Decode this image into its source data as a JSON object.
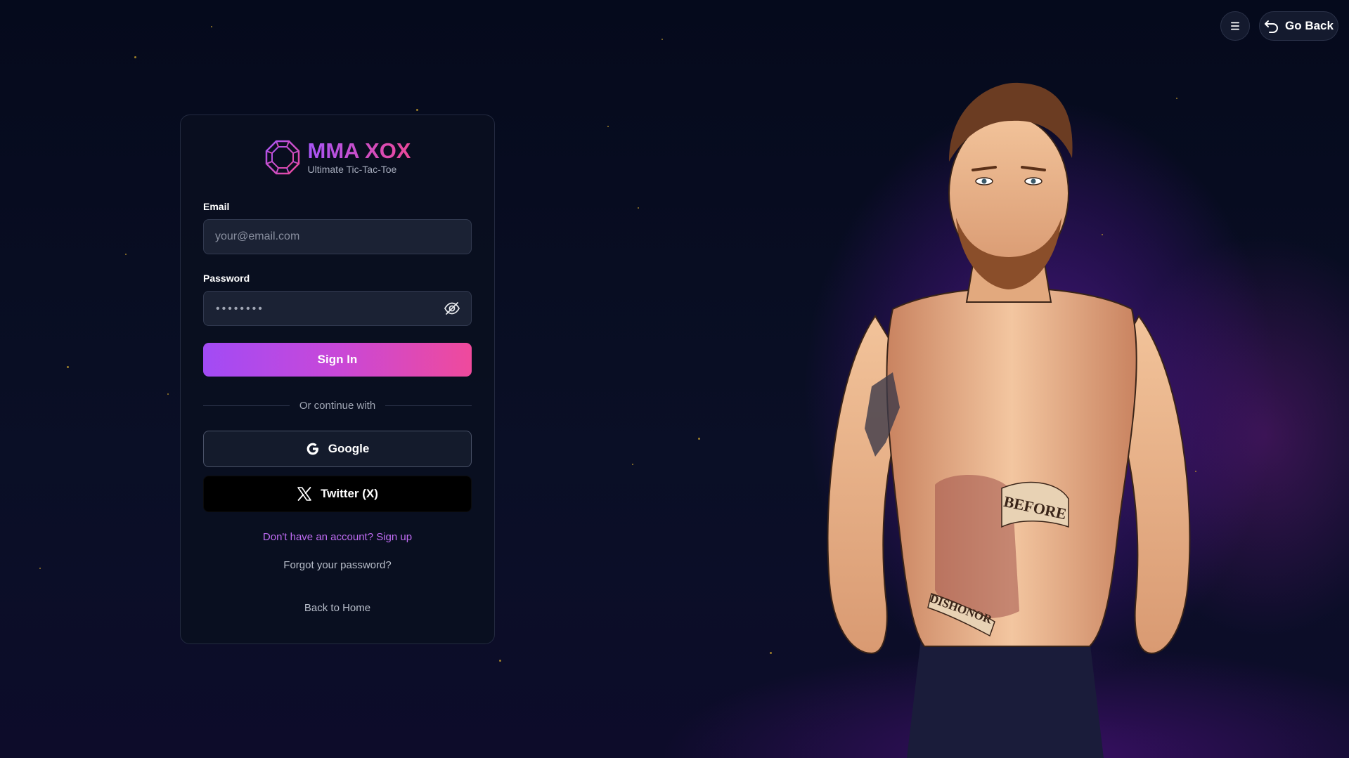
{
  "header": {
    "menu_icon": "hamburger-menu-icon",
    "go_back_label": "Go Back",
    "go_back_icon": "undo-arrow-icon"
  },
  "brand": {
    "logo_icon": "octagon-ring-logo-icon",
    "title": "MMA XOX",
    "subtitle": "Ultimate Tic-Tac-Toe"
  },
  "form": {
    "email_label": "Email",
    "email_placeholder": "your@email.com",
    "password_label": "Password",
    "password_value": "••••••••",
    "password_toggle_icon": "eye-off-icon",
    "sign_in_label": "Sign In",
    "divider_text": "Or continue with",
    "google_label": "Google",
    "google_icon": "google-g-icon",
    "twitter_label": "Twitter (X)",
    "twitter_icon": "x-logo-icon",
    "signup_link": "Don't have an account? Sign up",
    "forgot_link": "Forgot your password?",
    "home_link": "Back to Home"
  },
  "illustration": {
    "description_icon": "fighter-illustration",
    "tattoo_text_1": "BEFORE",
    "tattoo_text_2": "DISHONOR"
  },
  "colors": {
    "accent_start": "#a24bf5",
    "accent_end": "#ef4a9c",
    "signup_link": "#c06cf4",
    "background": "#070b1f"
  }
}
